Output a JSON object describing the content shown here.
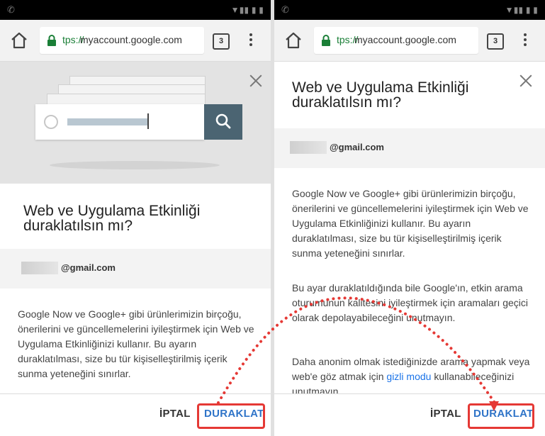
{
  "browser": {
    "url_prefix": "tps://",
    "url_host": "myaccount.google.com",
    "tab_count": "3"
  },
  "dialog": {
    "title_line1": "Web ve Uygulama Etkinliği",
    "title_line2": "duraklatılsın mı?",
    "email_suffix": "@gmail.com",
    "para1": "Google Now ve Google+ gibi ürünlerimizin birçoğu, önerilerini ve güncellemelerini iyileştirmek için Web ve Uygulama Etkinliğinizi kullanır. Bu ayarın duraklatılması, size bu tür kişiselleştirilmiş içerik sunma yeteneğini sınırlar.",
    "para2": "Bu ayar duraklatıldığında bile Google'ın, etkin arama oturumunun kalitesini iyileştirmek için aramaları geçici olarak depolayabileceğini unutmayın.",
    "para3_prefix": "Daha anonim olmak istediğinizde arama yapmak veya web'e göz atmak için ",
    "para3_link": "gizli modu",
    "para3_suffix": " kullanabileceğinizi unutmayın.",
    "cancel_label": "İPTAL",
    "pause_label": "DURAKLAT"
  },
  "colors": {
    "highlight": "#e53935",
    "link": "#1a73e8",
    "pause_button": "#2f74c8",
    "search_button": "#4b6472",
    "secure_url": "#1a7f37"
  }
}
